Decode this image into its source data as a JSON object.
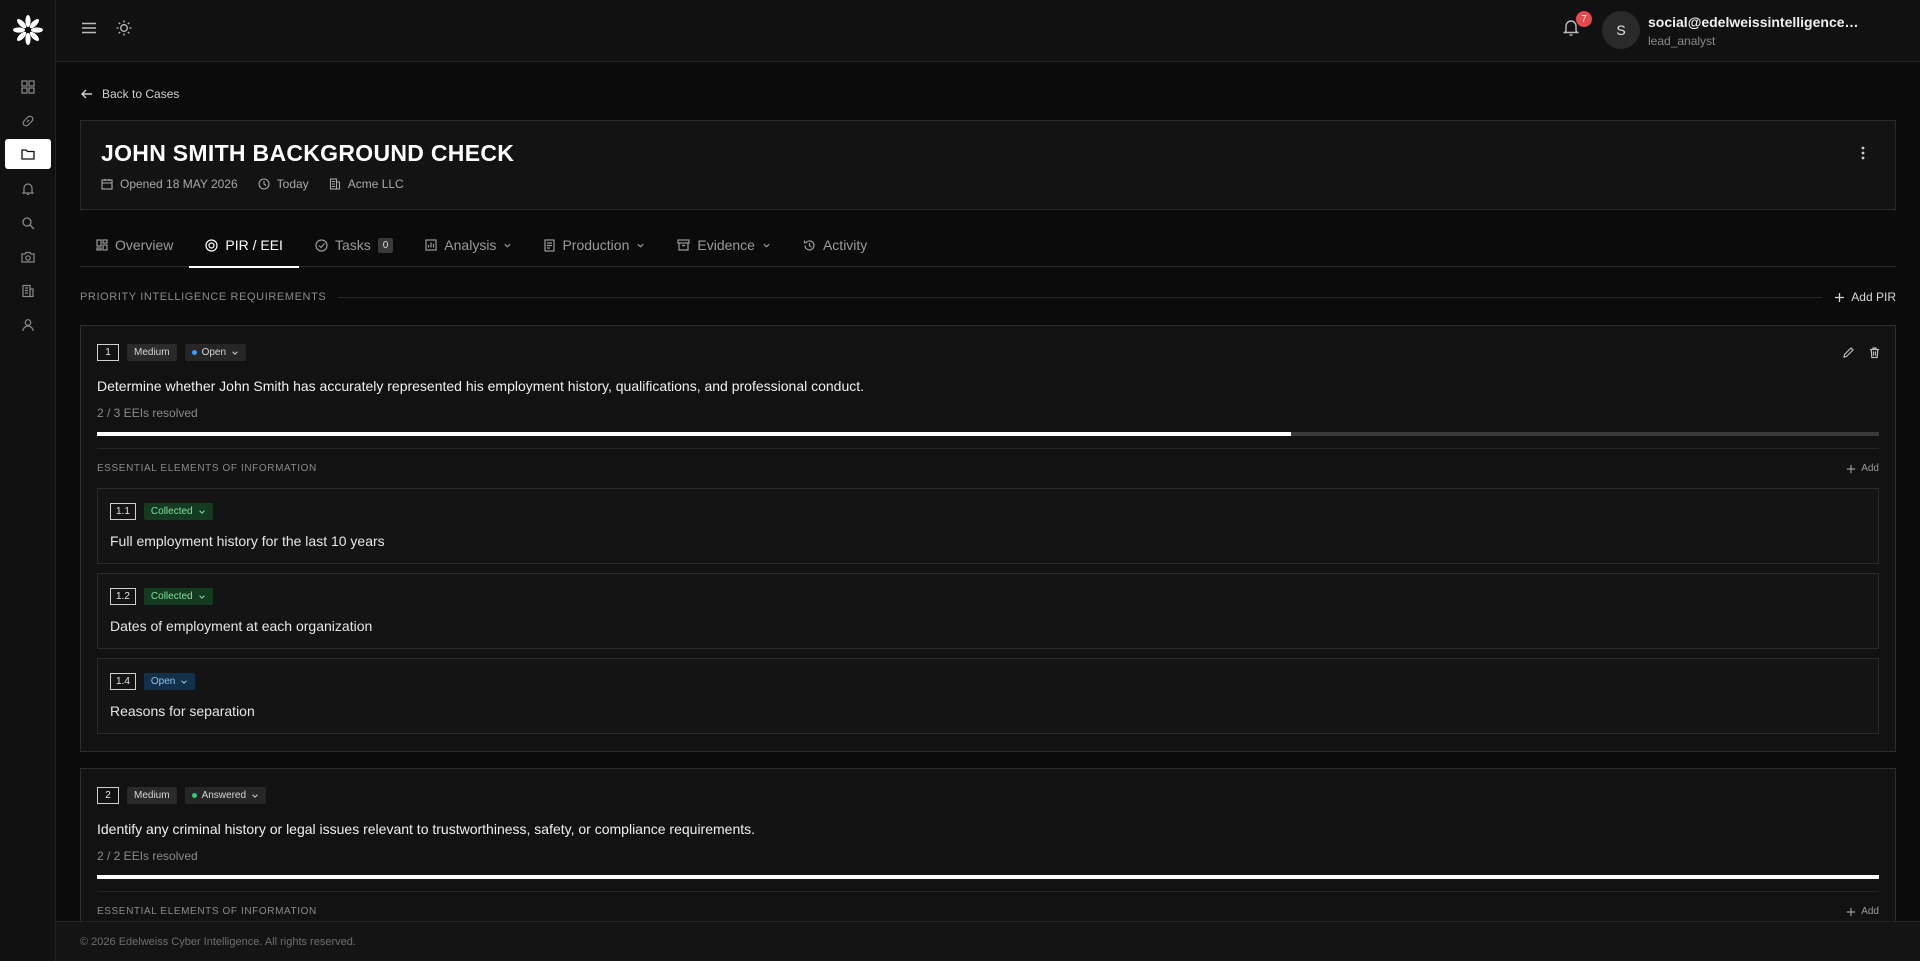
{
  "topbar": {
    "notifications_count": "7",
    "avatar_initial": "S",
    "user_email": "social@edelweissintelligence.com",
    "user_role": "lead_analyst"
  },
  "case": {
    "back_label": "Back to Cases",
    "title": "JOHN SMITH BACKGROUND CHECK",
    "opened": "Opened 18 MAY 2026",
    "updated": "Today",
    "client": "Acme LLC"
  },
  "tabs": [
    {
      "label": "Overview"
    },
    {
      "label": "PIR / EEI",
      "active": true
    },
    {
      "label": "Tasks",
      "count": "0"
    },
    {
      "label": "Analysis"
    },
    {
      "label": "Production"
    },
    {
      "label": "Evidence"
    },
    {
      "label": "Activity"
    }
  ],
  "pir_section": {
    "label": "PRIORITY INTELLIGENCE REQUIREMENTS",
    "add_label": "Add PIR"
  },
  "pirs": [
    {
      "number": "1",
      "priority": "Medium",
      "status": "Open",
      "status_color": "#3b9fff",
      "text": "Determine whether John Smith has accurately represented his employment history, qualifications, and professional conduct.",
      "resolved_text": "2 / 3 EEIs resolved",
      "progress": 0.67,
      "eei_label": "ESSENTIAL ELEMENTS OF INFORMATION",
      "eei_add": "Add",
      "eeis": [
        {
          "number": "1.1",
          "status": "Collected",
          "text": "Full employment history for the last 10 years"
        },
        {
          "number": "1.2",
          "status": "Collected",
          "text": "Dates of employment at each organization"
        },
        {
          "number": "1.4",
          "status": "Open",
          "text": "Reasons for separation"
        }
      ]
    },
    {
      "number": "2",
      "priority": "Medium",
      "status": "Answered",
      "status_color": "#2ecc71",
      "text": "Identify any criminal history or legal issues relevant to trustworthiness, safety, or compliance requirements.",
      "resolved_text": "2 / 2 EEIs resolved",
      "progress": 1.0,
      "eei_label": "ESSENTIAL ELEMENTS OF INFORMATION",
      "eei_add": "Add"
    }
  ],
  "footer": {
    "text": "© 2026 Edelweiss Cyber Intelligence. All rights reserved."
  },
  "colors": {
    "background": "#0b0b0b",
    "badge": "#e5484d",
    "collected": "#7fe0a0",
    "open": "#8cc4f0"
  }
}
